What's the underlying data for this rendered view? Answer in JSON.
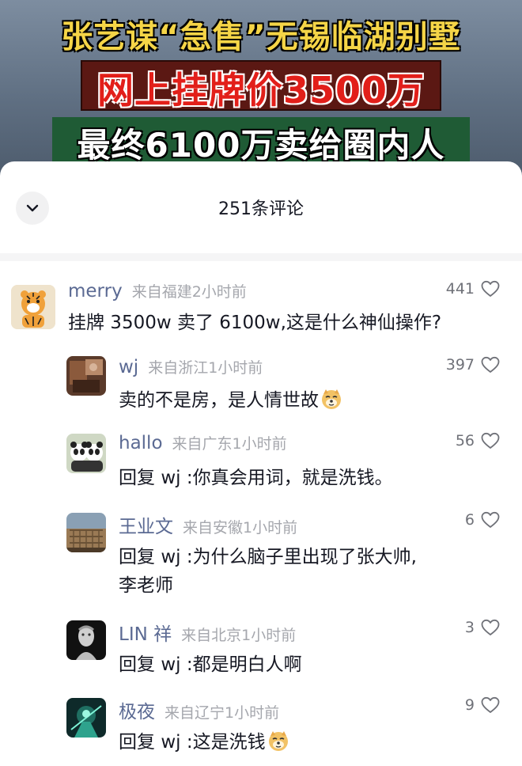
{
  "banner": {
    "line1": "张艺谋“急售”无锡临湖别墅",
    "line2": "网上挂牌价3500万",
    "line3": "最终6100万卖给圈内人"
  },
  "sheet": {
    "title": "251条评论",
    "collapse_icon": "chevron-down-icon"
  },
  "comments": [
    {
      "name": "merry",
      "location": "来自福建",
      "time": "2小时前",
      "likes": "441",
      "text": "挂牌 3500w 卖了 6100w,这是什么神仙操作?",
      "avatar": "tiger-avatar"
    },
    {
      "name": "wj",
      "location": "来自浙江",
      "time": "1小时前",
      "likes": "397",
      "text": "卖的不是房，是人情世故",
      "emoji": "doge-emoji",
      "avatar": "photo-avatar"
    },
    {
      "name": "hallo",
      "location": "来自广东",
      "time": "1小时前",
      "likes": "56",
      "reply_prefix": "回复",
      "reply_to": "wj",
      "text": ":你真会用词，就是洗钱。",
      "avatar": "panda-avatar"
    },
    {
      "name": "王业文",
      "location": "来自安徽",
      "time": "1小时前",
      "likes": "6",
      "reply_prefix": "回复",
      "reply_to": "wj",
      "text_line1": ":为什么脑子里出现了张大帅,",
      "text_line2": "李老师",
      "avatar": "colosseum-avatar"
    },
    {
      "name": "LIN 祥",
      "location": "来自北京",
      "time": "1小时前",
      "likes": "3",
      "reply_prefix": "回复",
      "reply_to": "wj",
      "text": ":都是明白人啊",
      "avatar": "statue-avatar"
    },
    {
      "name": "极夜",
      "location": "来自辽宁",
      "time": "1小时前",
      "likes": "9",
      "reply_prefix": "回复",
      "reply_to": "wj",
      "text": ":这是洗钱",
      "emoji": "doge-emoji",
      "avatar": "game-avatar"
    }
  ],
  "colors": {
    "name": "#5b6a93",
    "meta": "#a5a7ad",
    "text": "#161823"
  }
}
